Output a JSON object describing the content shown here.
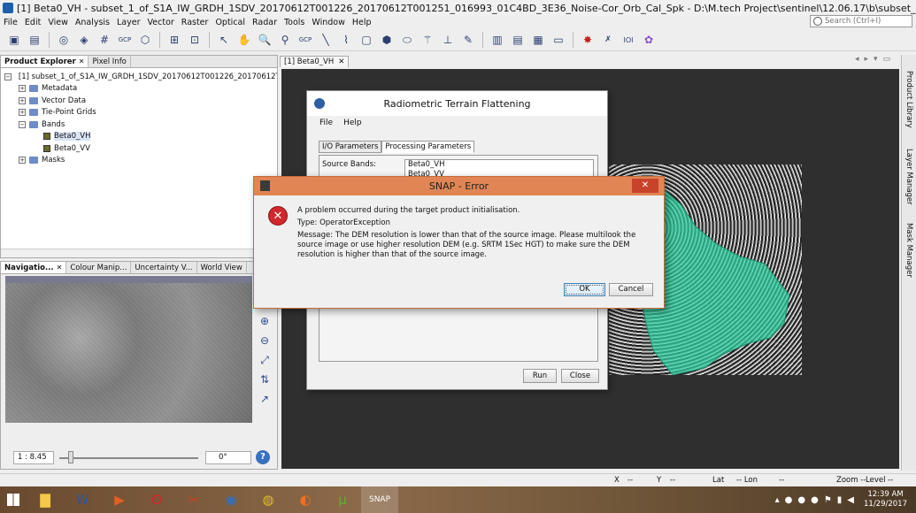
{
  "window": {
    "title": "[1] Beta0_VH - subset_1_of_S1A_IW_GRDH_1SDV_20170612T001226_20170612T001251_016993_01C4BD_3E36_Noise-Cor_Orb_Cal_Spk - D:\\M.tech Project\\sentinel\\12.06.17\\b\\subset_1_of..."
  },
  "menu": [
    "File",
    "Edit",
    "View",
    "Analysis",
    "Layer",
    "Vector",
    "Raster",
    "Optical",
    "Radar",
    "Tools",
    "Window",
    "Help"
  ],
  "search": {
    "placeholder": "Search (Ctrl+I)"
  },
  "toolbar": {
    "gcp1": "GCP",
    "gcp2": "GCP",
    "ioi": "IOI"
  },
  "explorer": {
    "tabs": [
      "Product Explorer",
      "Pixel Info"
    ],
    "product": "[1] subset_1_of_S1A_IW_GRDH_1SDV_20170612T001226_20170612T001",
    "nodes": [
      "Metadata",
      "Vector Data",
      "Tie-Point Grids",
      "Bands",
      "Masks"
    ],
    "bands": [
      "Beta0_VH",
      "Beta0_VV"
    ]
  },
  "nav": {
    "tabs": [
      "Navigatio...",
      "Colour Manip...",
      "Uncertainty V...",
      "World View"
    ],
    "scale": "1 : 8.45",
    "rotation": "0°"
  },
  "view": {
    "tab": "[1] Beta0_VH"
  },
  "rightbar": [
    "Product Library",
    "Layer Manager",
    "Mask Manager"
  ],
  "statusbar": {
    "x": "X",
    "dash1": "--",
    "y": "Y",
    "dash2": "--",
    "lat": "Lat",
    "lon": "-- Lon",
    "dash3": "--",
    "zoom": "Zoom --",
    "level": "Level --"
  },
  "rtf": {
    "title": "Radiometric Terrain Flattening",
    "menu": [
      "File",
      "Help"
    ],
    "tabs": [
      "I/O Parameters",
      "Processing Parameters"
    ],
    "source_bands_label": "Source Bands:",
    "source_bands": [
      "Beta0_VH",
      "Beta0_VV"
    ],
    "run": "Run",
    "close": "Close"
  },
  "error": {
    "title": "SNAP - Error",
    "line1": "A problem occurred during the target product initialisation.",
    "line2": "Type: OperatorException",
    "line3": "Message: The DEM resolution is lower than that of the source image. Please multilook the source image or use higher resolution DEM (e.g. SRTM 1Sec HGT) to make sure the DEM resolution is higher than that of the source image.",
    "ok": "OK",
    "cancel": "Cancel"
  },
  "taskbar": {
    "time": "12:39 AM",
    "date": "11/29/2017"
  },
  "colors": {
    "error_header": "#e08553",
    "canvas_bg": "#2f2f2f",
    "mask_fill": "#2fd3a3"
  }
}
